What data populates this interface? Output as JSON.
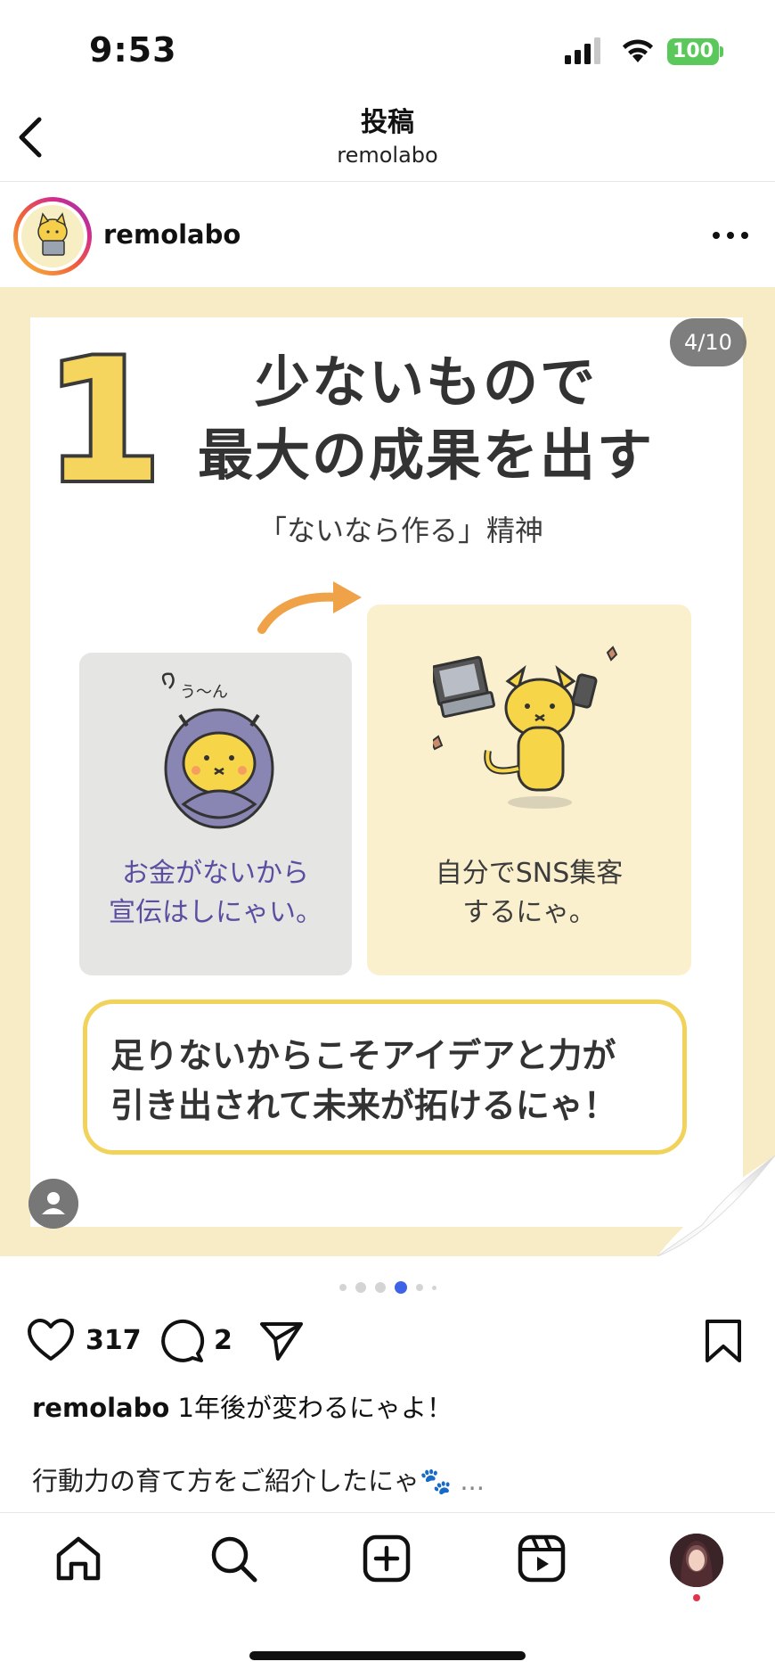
{
  "status_bar": {
    "time": "9:53",
    "battery": "100"
  },
  "header": {
    "title": "投稿",
    "subtitle": "remolabo"
  },
  "post": {
    "username": "remolabo",
    "image": {
      "counter": "4/10",
      "number": "1",
      "title_line1": "少ないもので",
      "title_line2": "最大の成果を出す",
      "subtitle": "「ないなら作る」精神",
      "cat_thought": "う〜ん",
      "left_caption_line1": "お金がないから",
      "left_caption_line2": "宣伝はしにゃい。",
      "right_caption_line1": "自分でSNS集客",
      "right_caption_line2": "するにゃ。",
      "callout_line1": "足りないからこそアイデアと力が",
      "callout_line2": "引き出されて未来が拓けるにゃ！"
    },
    "likes": "317",
    "comments": "2",
    "caption_user": "remolabo",
    "caption_text": "1年後が変わるにゃよ！",
    "caption_line2": "行動力の育て方をご紹介したにゃ🐾",
    "more": "..."
  },
  "icons": {
    "back": "chevron-left-icon",
    "more": "ellipsis-icon",
    "like": "heart-icon",
    "comment": "comment-bubble-icon",
    "share": "paper-plane-icon",
    "save": "bookmark-icon",
    "nav": [
      "home-icon",
      "search-icon",
      "create-icon",
      "reels-icon",
      "profile-avatar"
    ]
  },
  "colors": {
    "accent_dot": "#3f63e8",
    "battery": "#5ac85a",
    "image_bg": "#f8ecc6",
    "callout_border": "#f1d25b"
  }
}
